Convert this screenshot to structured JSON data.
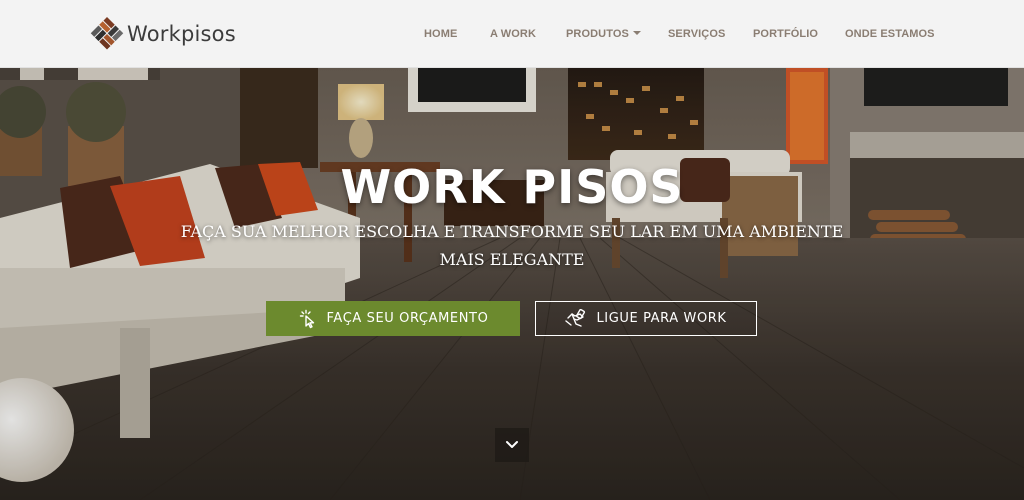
{
  "brand": {
    "name": "Workpisos",
    "logo_icon": "parquet-blocks-icon"
  },
  "nav": {
    "items": [
      {
        "label": "HOME"
      },
      {
        "label": "A WORK"
      },
      {
        "label": "PRODUTOS",
        "has_dropdown": true
      },
      {
        "label": "SERVIÇOS"
      },
      {
        "label": "PORTFÓLIO"
      },
      {
        "label": "ONDE ESTAMOS"
      }
    ]
  },
  "hero": {
    "title": "WORK PISOS",
    "subtitle": "FAÇA SUA MELHOR ESCOLHA E TRANSFORME SEU LAR EM UMA AMBIENTE MAIS ELEGANTE",
    "primary_button": {
      "label": "FAÇA SEU ORÇAMENTO",
      "icon": "pointer-click-icon"
    },
    "secondary_button": {
      "label": "LIGUE PARA WORK",
      "icon": "hand-phone-icon"
    },
    "scroll_icon": "chevron-down-icon"
  },
  "colors": {
    "nav_bg": "#f3f3f3",
    "nav_text": "#8a7d72",
    "primary_button": "#6c8a2e",
    "text_light": "#ffffff"
  }
}
